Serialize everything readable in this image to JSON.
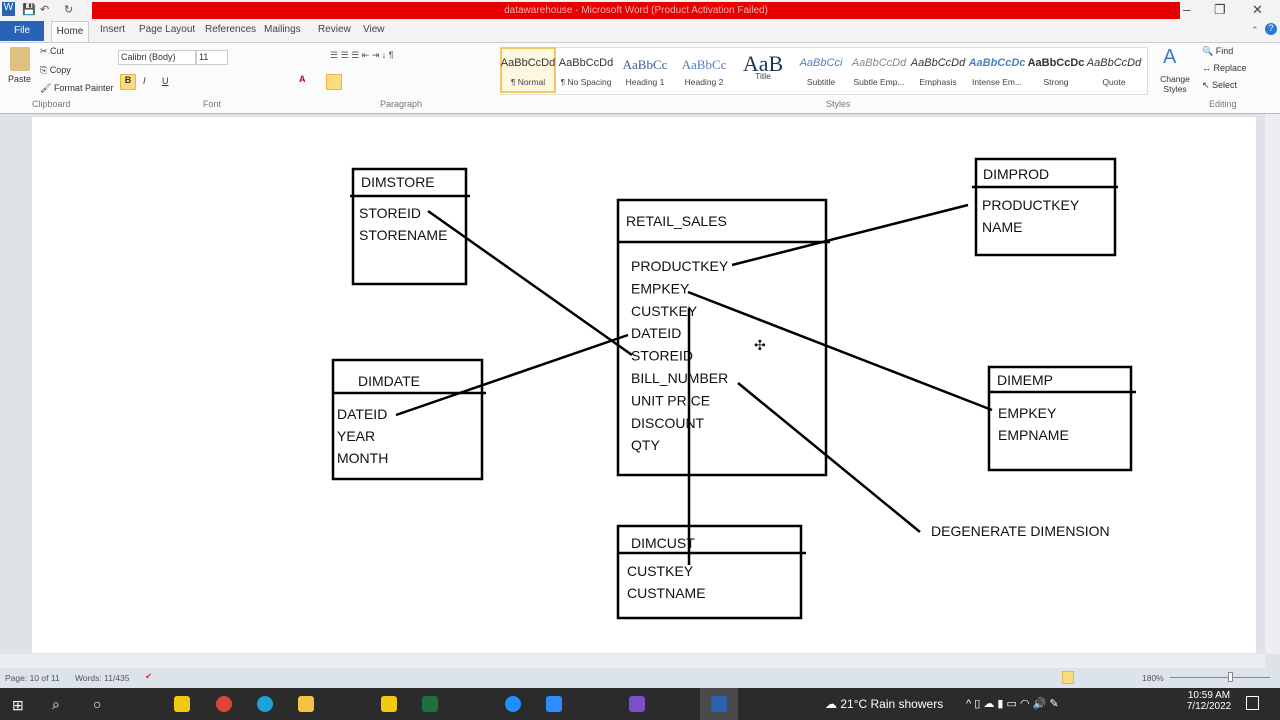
{
  "window": {
    "title": "datawarehouse - Microsoft Word (Product Activation Failed)"
  },
  "tabs": [
    "File",
    "Home",
    "Insert",
    "Page Layout",
    "References",
    "Mailings",
    "Review",
    "View"
  ],
  "ribbon": {
    "clipboard": {
      "paste": "Paste",
      "cut": "Cut",
      "copy": "Copy",
      "format_painter": "Format Painter",
      "label": "Clipboard"
    },
    "font": {
      "name": "Calibri (Body)",
      "size": "11",
      "label": "Font"
    },
    "paragraph": {
      "label": "Paragraph"
    },
    "styles": {
      "label": "Styles",
      "items": [
        {
          "sample": "AaBbCcDd",
          "name": "¶ Normal"
        },
        {
          "sample": "AaBbCcDd",
          "name": "¶ No Spacing"
        },
        {
          "sample": "AaBbCc",
          "name": "Heading 1"
        },
        {
          "sample": "AaBbCc",
          "name": "Heading 2"
        },
        {
          "sample": "AaB",
          "name": "Title"
        },
        {
          "sample": "AaBbCci",
          "name": "Subtitle"
        },
        {
          "sample": "AaBbCcDd",
          "name": "Subtle Emp..."
        },
        {
          "sample": "AaBbCcDd",
          "name": "Emphasis"
        },
        {
          "sample": "AaBbCcDc",
          "name": "Intense Em..."
        },
        {
          "sample": "AaBbCcDc",
          "name": "Strong"
        },
        {
          "sample": "AaBbCcDd",
          "name": "Quote"
        }
      ],
      "change_styles": "Change Styles"
    },
    "editing": {
      "find": "Find",
      "replace": "Replace",
      "select": "Select",
      "label": "Editing"
    }
  },
  "diagram": {
    "dimstore": {
      "title": "DIMSTORE",
      "fields": [
        "STOREID",
        "STORENAME"
      ]
    },
    "retail_sales": {
      "title": "RETAIL_SALES",
      "fields": [
        "PRODUCTKEY",
        "EMPKEY",
        "CUSTKEY",
        "DATEID",
        "STOREID",
        "BILL_NUMBER",
        "UNIT PRICE",
        "DISCOUNT",
        "QTY"
      ]
    },
    "dimprod": {
      "title": "DIMPROD",
      "fields": [
        "PRODUCTKEY",
        "NAME"
      ]
    },
    "dimdate": {
      "title": "DIMDATE",
      "fields": [
        "DATEID",
        "YEAR",
        "MONTH"
      ]
    },
    "dimemp": {
      "title": "DIMEMP",
      "fields": [
        "EMPKEY",
        "EMPNAME"
      ]
    },
    "dimcust": {
      "title": "DIMCUST",
      "fields": [
        "CUSTKEY",
        "CUSTNAME"
      ]
    },
    "note": "DEGENERATE DIMENSION"
  },
  "status": {
    "page": "Page: 10 of 11",
    "words": "Words: 11/435",
    "zoom": "180%"
  },
  "taskbar": {
    "weather": "21°C  Rain showers",
    "time": "10:59 AM",
    "date": "7/12/2022"
  }
}
